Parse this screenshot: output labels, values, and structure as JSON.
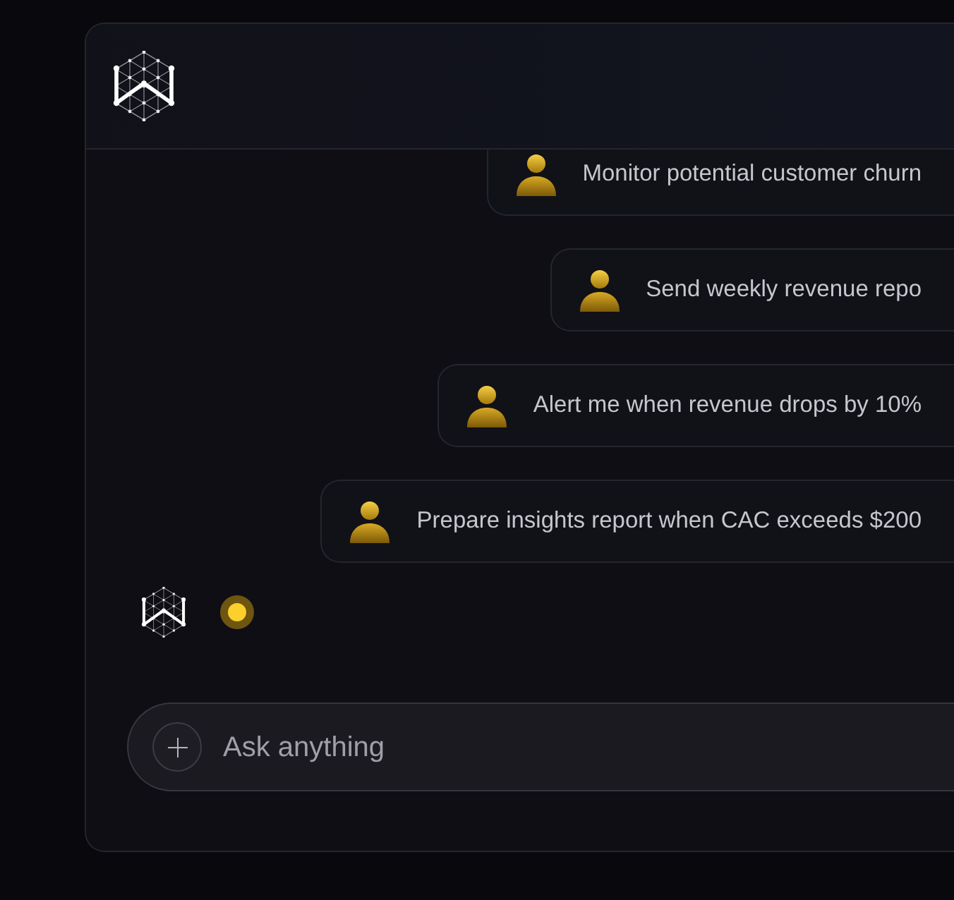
{
  "messages": [
    {
      "text": "Monitor potential customer churn"
    },
    {
      "text": "Send weekly revenue repo"
    },
    {
      "text": "Alert me when revenue drops by 10%"
    },
    {
      "text": "Prepare insights report when CAC exceeds $200"
    }
  ],
  "assistant": {
    "typing": true
  },
  "composer": {
    "placeholder": "Ask anything"
  }
}
